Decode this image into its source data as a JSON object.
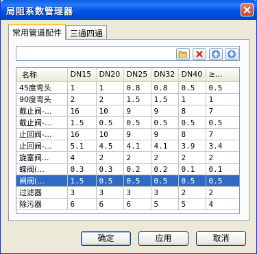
{
  "window": {
    "title": "局阻系数管理器"
  },
  "tabs": [
    {
      "label": "常用管道配件"
    },
    {
      "label": "三通四通"
    }
  ],
  "toolbar": {
    "buttons": [
      {
        "icon": "folder-icon"
      },
      {
        "icon": "delete-icon"
      },
      {
        "icon": "arrow-up-icon"
      },
      {
        "icon": "arrow-down-icon"
      }
    ]
  },
  "table": {
    "headers": [
      "名称",
      "DN15",
      "DN20",
      "DN25",
      "DN32",
      "DN40",
      "≥..."
    ],
    "rows": [
      {
        "cells": [
          "45度弯头",
          "1",
          "1",
          "0.8",
          "0.8",
          "0.5",
          "0.5"
        ]
      },
      {
        "cells": [
          "90度弯头",
          "2",
          "2",
          "1.5",
          "1.5",
          "1",
          "1"
        ]
      },
      {
        "cells": [
          "截止阀-...",
          "16",
          "10",
          "9",
          "9",
          "8",
          "7"
        ]
      },
      {
        "cells": [
          "截止阀-...",
          "1.5",
          "0.5",
          "0.5",
          "0.5",
          "0.5",
          "0.5"
        ]
      },
      {
        "cells": [
          "止回阀-...",
          "16",
          "10",
          "9",
          "9",
          "8",
          "7"
        ]
      },
      {
        "cells": [
          "止回阀-...",
          "5.1",
          "4.5",
          "4.1",
          "4.1",
          "3.9",
          "3.4"
        ]
      },
      {
        "cells": [
          "旋塞阀...",
          "4",
          "2",
          "2",
          "2",
          "2",
          "2"
        ]
      },
      {
        "cells": [
          "蝶阀(...",
          "0.3",
          "0.3",
          "0.2",
          "0.2",
          "0.1",
          "0.1"
        ]
      },
      {
        "cells": [
          "闸阀(...",
          "1.5",
          "0.5",
          "0.5",
          "0.5",
          "0.5",
          "0.5"
        ],
        "selected": true
      },
      {
        "cells": [
          "过滤器",
          "3",
          "3",
          "3",
          "3",
          "2",
          "2"
        ]
      },
      {
        "cells": [
          "除污器",
          "6",
          "6",
          "6",
          "5",
          "5",
          "4"
        ]
      }
    ]
  },
  "buttons": {
    "ok": "确定",
    "apply": "应用",
    "cancel": "取消"
  },
  "colors": {
    "title_bar": "#0054E3",
    "selection": "#316AC5",
    "close_button": "#D9532C"
  }
}
